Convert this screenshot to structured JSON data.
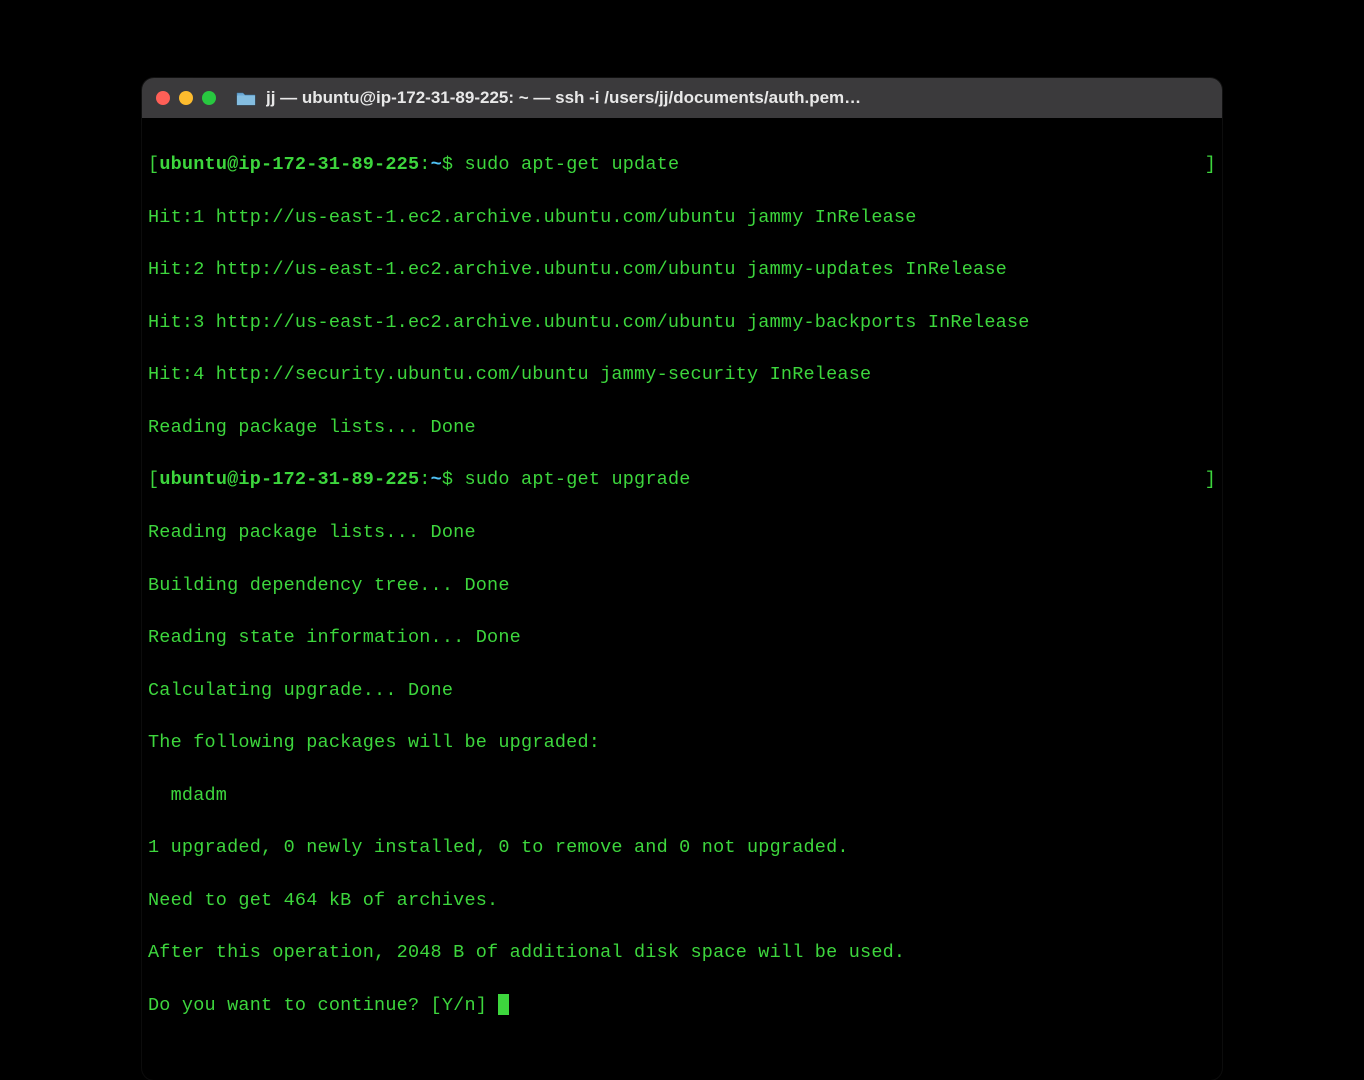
{
  "window": {
    "title": "jj — ubuntu@ip-172-31-89-225: ~ — ssh -i /users/jj/documents/auth.pem…"
  },
  "prompt": {
    "open_bracket": "[",
    "host": "ubuntu@ip-172-31-89-225",
    "colon": ":",
    "path": "~",
    "dollar": "$",
    "close_bracket": "]"
  },
  "session": {
    "cmd1": "sudo apt-get update",
    "out1": [
      "Hit:1 http://us-east-1.ec2.archive.ubuntu.com/ubuntu jammy InRelease",
      "Hit:2 http://us-east-1.ec2.archive.ubuntu.com/ubuntu jammy-updates InRelease",
      "Hit:3 http://us-east-1.ec2.archive.ubuntu.com/ubuntu jammy-backports InRelease",
      "Hit:4 http://security.ubuntu.com/ubuntu jammy-security InRelease",
      "Reading package lists... Done"
    ],
    "cmd2": "sudo apt-get upgrade",
    "out2": [
      "Reading package lists... Done",
      "Building dependency tree... Done",
      "Reading state information... Done",
      "Calculating upgrade... Done",
      "The following packages will be upgraded:",
      "  mdadm",
      "1 upgraded, 0 newly installed, 0 to remove and 0 not upgraded.",
      "Need to get 464 kB of archives.",
      "After this operation, 2048 B of additional disk space will be used."
    ],
    "continue_prompt": "Do you want to continue? [Y/n] "
  }
}
